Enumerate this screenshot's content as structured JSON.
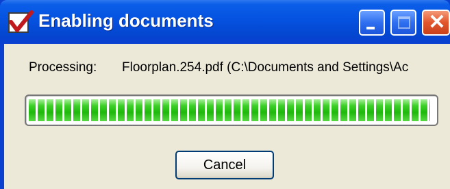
{
  "window": {
    "title": "Enabling documents",
    "controls": [
      "minimize-icon",
      "maximize-icon",
      "close-icon"
    ]
  },
  "status": {
    "label": "Processing:",
    "file": "Floorplan.254.pdf (C:\\Documents and Settings\\Ac"
  },
  "progress": {
    "fraction": 0.99
  },
  "buttons": {
    "cancel": "Cancel"
  },
  "colors": {
    "titlebar": "#0552e0",
    "progress_fill": "#1fb80c",
    "dialog_bg": "#ece9d8",
    "close_button": "#e2562c"
  }
}
